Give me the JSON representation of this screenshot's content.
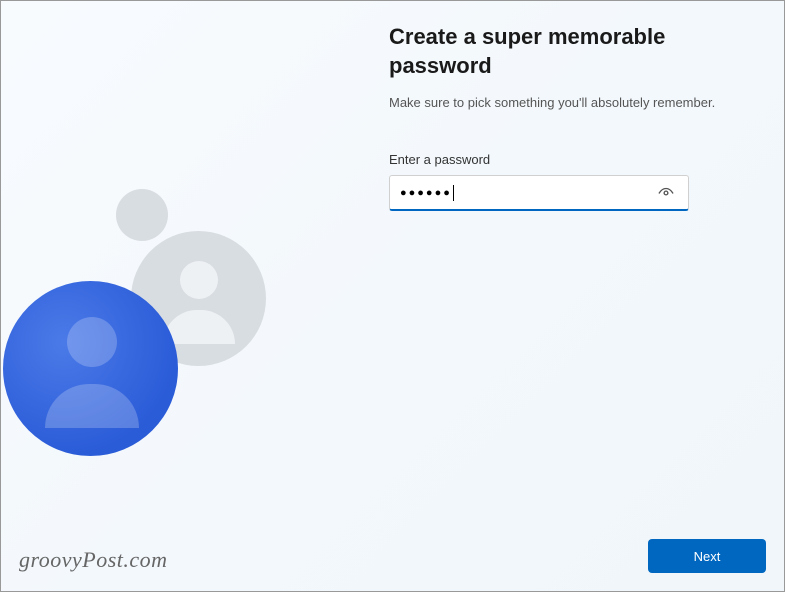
{
  "header": {
    "title": "Create a super memorable password",
    "subtitle": "Make sure to pick something you'll absolutely remember."
  },
  "form": {
    "password_label": "Enter a password",
    "password_masked": "●●●●●●",
    "placeholder": ""
  },
  "buttons": {
    "next": "Next"
  },
  "watermark": "groovyPost.com"
}
